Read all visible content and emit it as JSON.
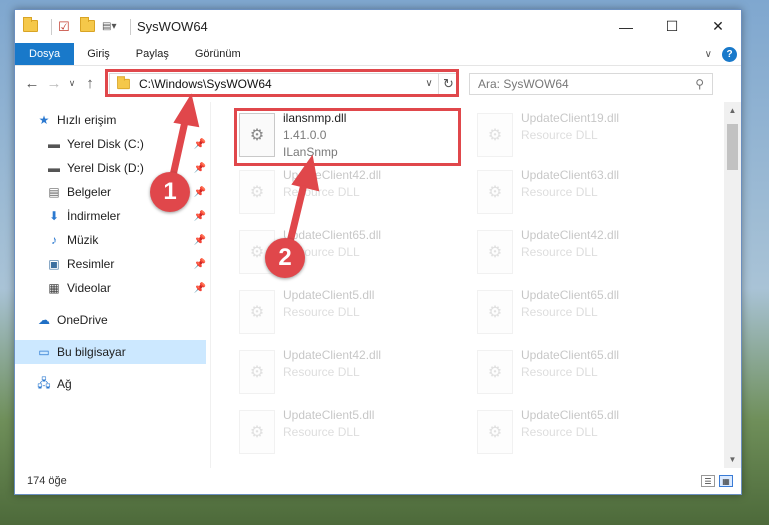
{
  "window": {
    "title": "SysWOW64",
    "controls": {
      "minimize": "—",
      "maximize": "☐",
      "close": "✕"
    }
  },
  "ribbon": {
    "tabs": [
      "Dosya",
      "Giriş",
      "Paylaş",
      "Görünüm"
    ]
  },
  "address": {
    "path": "C:\\Windows\\SysWOW64",
    "search_placeholder": "Ara: SysWOW64"
  },
  "navpane": {
    "quick_access": "Hızlı erişim",
    "items": [
      {
        "label": "Yerel Disk (C:)",
        "icon": "drive-icon"
      },
      {
        "label": "Yerel Disk (D:)",
        "icon": "drive-icon"
      },
      {
        "label": "Belgeler",
        "icon": "documents-icon"
      },
      {
        "label": "İndirmeler",
        "icon": "downloads-icon"
      },
      {
        "label": "Müzik",
        "icon": "music-icon"
      },
      {
        "label": "Resimler",
        "icon": "pictures-icon"
      },
      {
        "label": "Videolar",
        "icon": "videos-icon"
      }
    ],
    "onedrive": "OneDrive",
    "this_pc": "Bu bilgisayar",
    "network": "Ağ"
  },
  "files": [
    {
      "name": "ilansnmp.dll",
      "line2": "1.41.0.0",
      "line3": "ILanSnmp",
      "highlighted": true
    },
    {
      "name": "UpdateClient19.dll",
      "line2": "Resource DLL"
    },
    {
      "name": "UpdateClient42.dll",
      "line2": "Resource DLL"
    },
    {
      "name": "UpdateClient63.dll",
      "line2": "Resource DLL"
    },
    {
      "name": "UpdateClient65.dll",
      "line2": "Resource DLL"
    },
    {
      "name": "UpdateClient42.dll",
      "line2": "Resource DLL"
    },
    {
      "name": "UpdateClient5.dll",
      "line2": "Resource DLL"
    },
    {
      "name": "UpdateClient65.dll",
      "line2": "Resource DLL"
    },
    {
      "name": "UpdateClient42.dll",
      "line2": "Resource DLL"
    },
    {
      "name": "UpdateClient65.dll",
      "line2": "Resource DLL"
    },
    {
      "name": "UpdateClient5.dll",
      "line2": "Resource DLL"
    },
    {
      "name": "UpdateClient65.dll",
      "line2": "Resource DLL"
    }
  ],
  "status": {
    "count": "174 öğe"
  },
  "annotations": {
    "badge1": "1",
    "badge2": "2"
  },
  "colors": {
    "accent": "#1979ca",
    "highlight": "#e0474b",
    "selected": "#cce8ff"
  }
}
